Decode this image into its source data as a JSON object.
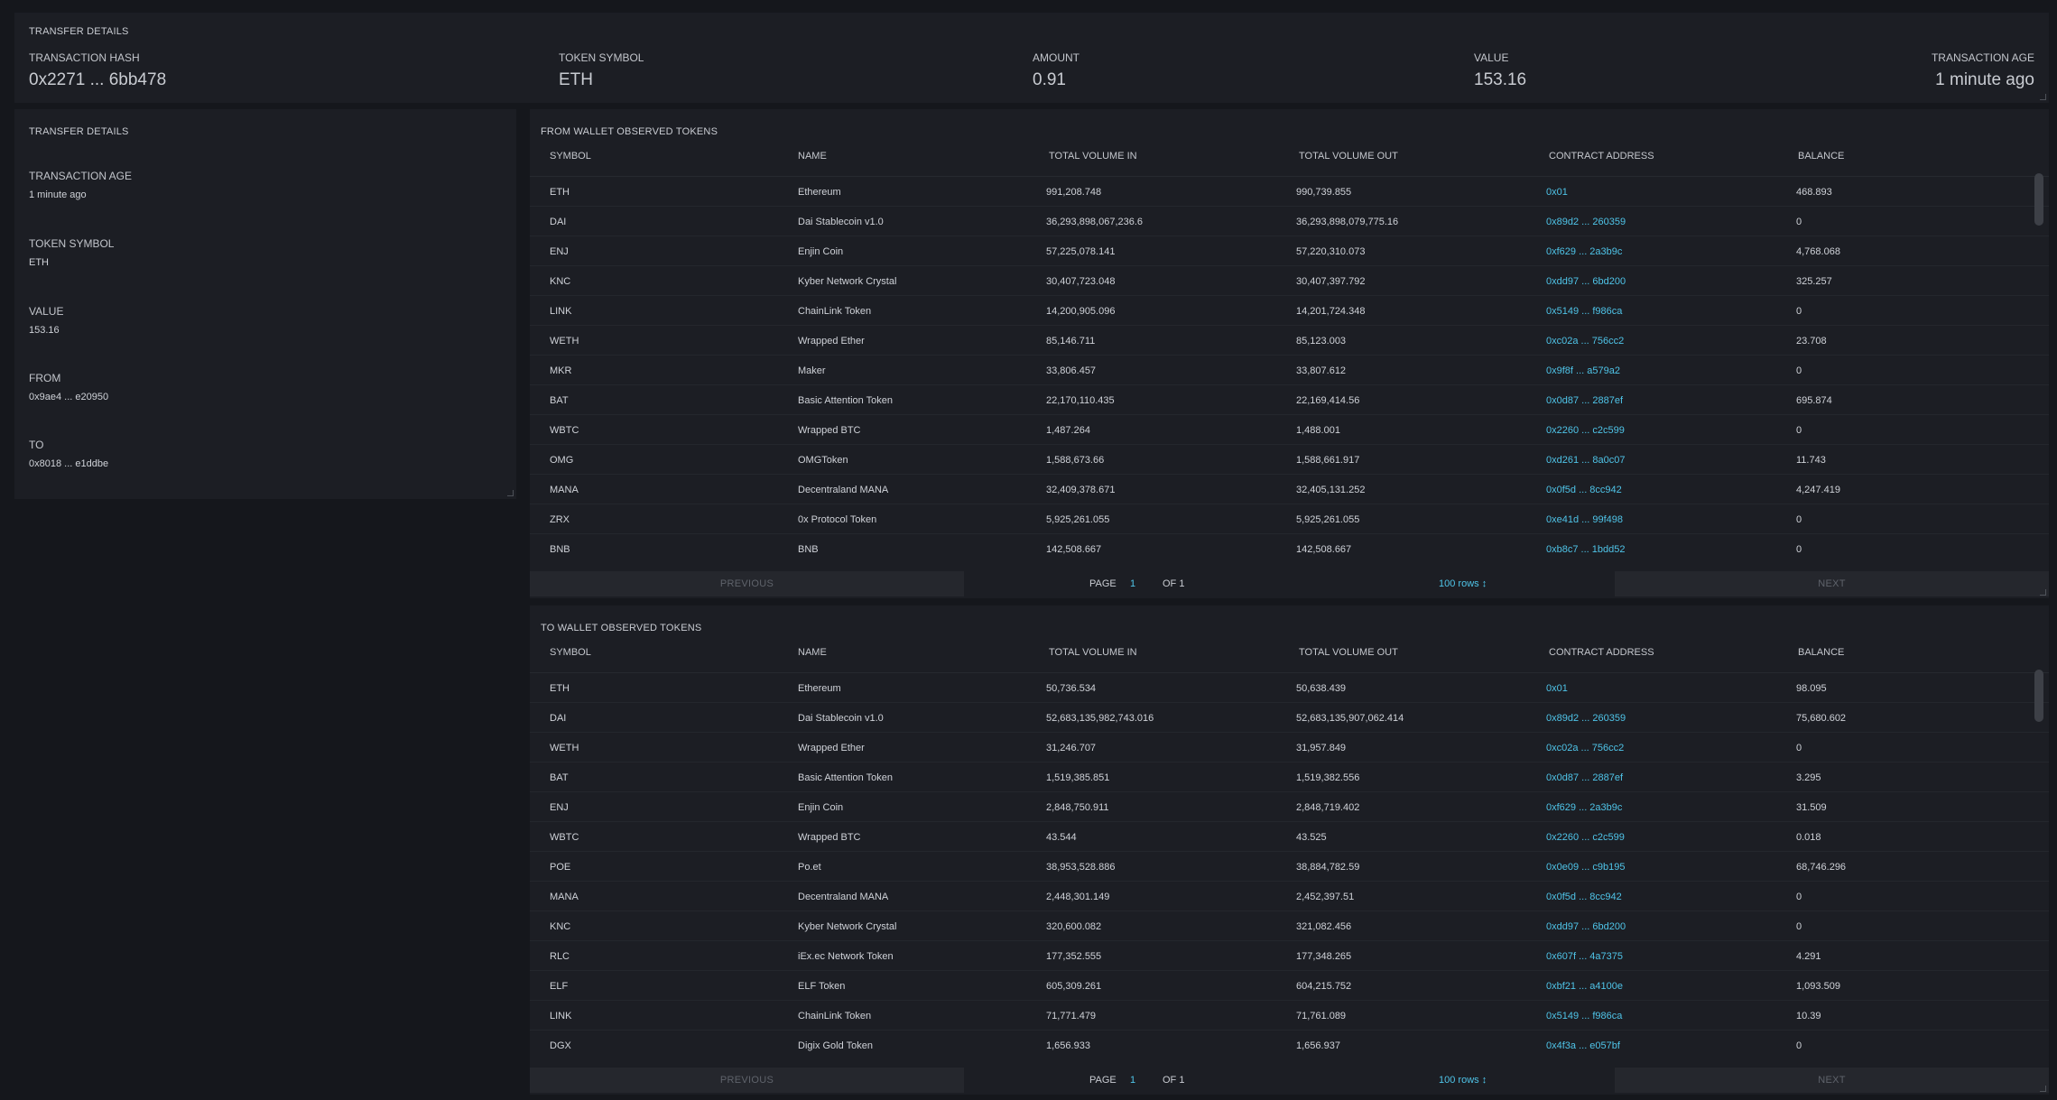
{
  "summary": {
    "title": "TRANSFER DETAILS",
    "hash_label": "TRANSACTION HASH",
    "hash_value": "0x2271 ... 6bb478",
    "symbol_label": "TOKEN SYMBOL",
    "symbol_value": "ETH",
    "amount_label": "AMOUNT",
    "amount_value": "0.91",
    "value_label": "VALUE",
    "value_value": "153.16",
    "age_label": "TRANSACTION AGE",
    "age_value": "1 minute ago"
  },
  "details": {
    "title": "TRANSFER DETAILS",
    "age_label": "TRANSACTION AGE",
    "age_value": "1 minute ago",
    "symbol_label": "TOKEN SYMBOL",
    "symbol_value": "ETH",
    "value_label": "VALUE",
    "value_value": "153.16",
    "from_label": "FROM",
    "from_value": "0x9ae4 ... e20950",
    "to_label": "TO",
    "to_value": "0x8018 ... e1ddbe"
  },
  "columns": [
    "SYMBOL",
    "NAME",
    "TOTAL VOLUME IN",
    "TOTAL VOLUME OUT",
    "CONTRACT ADDRESS",
    "BALANCE"
  ],
  "pager": {
    "previous": "PREVIOUS",
    "page": "PAGE",
    "page_num": "1",
    "of": "OF 1",
    "rows": "100 rows ↕",
    "next": "NEXT"
  },
  "from_table": {
    "title": "FROM WALLET OBSERVED TOKENS",
    "rows": [
      [
        "ETH",
        "Ethereum",
        "991,208.748",
        "990,739.855",
        "0x01",
        "468.893"
      ],
      [
        "DAI",
        "Dai Stablecoin v1.0",
        "36,293,898,067,236.6",
        "36,293,898,079,775.16",
        "0x89d2 ... 260359",
        "0"
      ],
      [
        "ENJ",
        "Enjin Coin",
        "57,225,078.141",
        "57,220,310.073",
        "0xf629 ... 2a3b9c",
        "4,768.068"
      ],
      [
        "KNC",
        "Kyber Network Crystal",
        "30,407,723.048",
        "30,407,397.792",
        "0xdd97 ... 6bd200",
        "325.257"
      ],
      [
        "LINK",
        "ChainLink Token",
        "14,200,905.096",
        "14,201,724.348",
        "0x5149 ... f986ca",
        "0"
      ],
      [
        "WETH",
        "Wrapped Ether",
        "85,146.711",
        "85,123.003",
        "0xc02a ... 756cc2",
        "23.708"
      ],
      [
        "MKR",
        "Maker",
        "33,806.457",
        "33,807.612",
        "0x9f8f ... a579a2",
        "0"
      ],
      [
        "BAT",
        "Basic Attention Token",
        "22,170,110.435",
        "22,169,414.56",
        "0x0d87 ... 2887ef",
        "695.874"
      ],
      [
        "WBTC",
        "Wrapped BTC",
        "1,487.264",
        "1,488.001",
        "0x2260 ... c2c599",
        "0"
      ],
      [
        "OMG",
        "OMGToken",
        "1,588,673.66",
        "1,588,661.917",
        "0xd261 ... 8a0c07",
        "11.743"
      ],
      [
        "MANA",
        "Decentraland MANA",
        "32,409,378.671",
        "32,405,131.252",
        "0x0f5d ... 8cc942",
        "4,247.419"
      ],
      [
        "ZRX",
        "0x Protocol Token",
        "5,925,261.055",
        "5,925,261.055",
        "0xe41d ... 99f498",
        "0"
      ],
      [
        "BNB",
        "BNB",
        "142,508.667",
        "142,508.667",
        "0xb8c7 ... 1bdd52",
        "0"
      ]
    ]
  },
  "to_table": {
    "title": "TO WALLET OBSERVED TOKENS",
    "rows": [
      [
        "ETH",
        "Ethereum",
        "50,736.534",
        "50,638.439",
        "0x01",
        "98.095"
      ],
      [
        "DAI",
        "Dai Stablecoin v1.0",
        "52,683,135,982,743.016",
        "52,683,135,907,062.414",
        "0x89d2 ... 260359",
        "75,680.602"
      ],
      [
        "WETH",
        "Wrapped Ether",
        "31,246.707",
        "31,957.849",
        "0xc02a ... 756cc2",
        "0"
      ],
      [
        "BAT",
        "Basic Attention Token",
        "1,519,385.851",
        "1,519,382.556",
        "0x0d87 ... 2887ef",
        "3.295"
      ],
      [
        "ENJ",
        "Enjin Coin",
        "2,848,750.911",
        "2,848,719.402",
        "0xf629 ... 2a3b9c",
        "31.509"
      ],
      [
        "WBTC",
        "Wrapped BTC",
        "43.544",
        "43.525",
        "0x2260 ... c2c599",
        "0.018"
      ],
      [
        "POE",
        "Po.et",
        "38,953,528.886",
        "38,884,782.59",
        "0x0e09 ... c9b195",
        "68,746.296"
      ],
      [
        "MANA",
        "Decentraland MANA",
        "2,448,301.149",
        "2,452,397.51",
        "0x0f5d ... 8cc942",
        "0"
      ],
      [
        "KNC",
        "Kyber Network Crystal",
        "320,600.082",
        "321,082.456",
        "0xdd97 ... 6bd200",
        "0"
      ],
      [
        "RLC",
        "iEx.ec Network Token",
        "177,352.555",
        "177,348.265",
        "0x607f ... 4a7375",
        "4.291"
      ],
      [
        "ELF",
        "ELF Token",
        "605,309.261",
        "604,215.752",
        "0xbf21 ... a4100e",
        "1,093.509"
      ],
      [
        "LINK",
        "ChainLink Token",
        "71,771.479",
        "71,761.089",
        "0x5149 ... f986ca",
        "10.39"
      ],
      [
        "DGX",
        "Digix Gold Token",
        "1,656.933",
        "1,656.937",
        "0x4f3a ... e057bf",
        "0"
      ]
    ]
  }
}
